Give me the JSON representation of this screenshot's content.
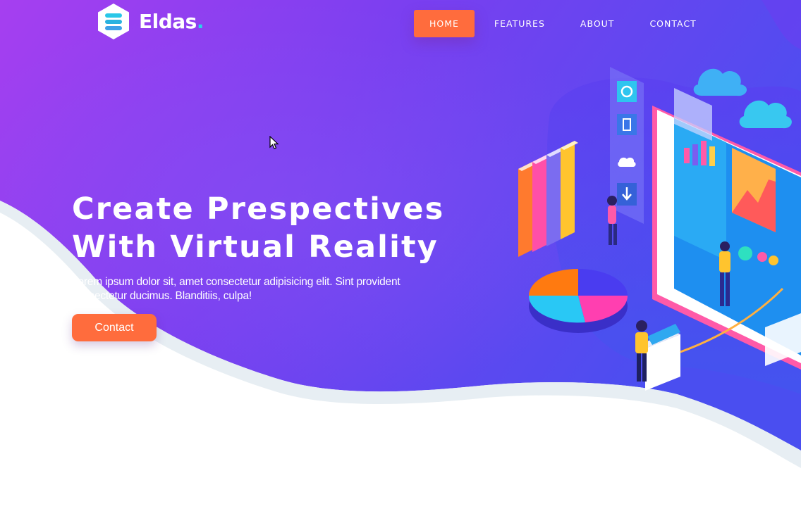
{
  "brand": {
    "name": "Eldas",
    "dot": "."
  },
  "nav": {
    "items": [
      {
        "label": "HOME",
        "active": true
      },
      {
        "label": "FEATURES",
        "active": false
      },
      {
        "label": "ABOUT",
        "active": false
      },
      {
        "label": "CONTACT",
        "active": false
      }
    ]
  },
  "hero": {
    "title_line1": "Create Prespectives",
    "title_line2": "With Virtual Reality",
    "description": "Lorem ipsum dolor sit, amet consectetur adipisicing elit. Sint provident consectetur ducimus. Blanditiis, culpa!",
    "cta_label": "Contact"
  },
  "colors": {
    "gradient_start": "#a63ff0",
    "gradient_end": "#4a4ef0",
    "accent": "#ff6c3d",
    "logo_dot": "#29d4e8"
  },
  "icons": [
    "logo-mark-icon",
    "cursor-icon",
    "cloud-icon",
    "gear-icon",
    "document-icon",
    "download-icon"
  ]
}
